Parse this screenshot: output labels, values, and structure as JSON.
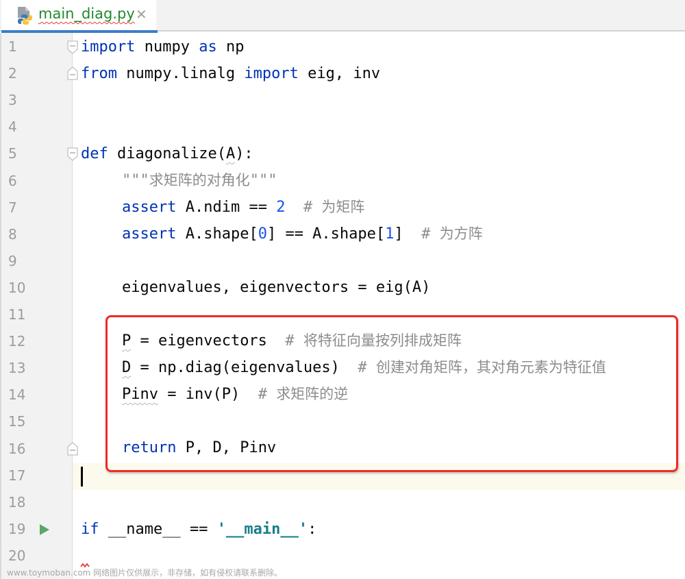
{
  "tab": {
    "filename": "main_diag.py",
    "close_symbol": "✕"
  },
  "gutter": {
    "line_numbers": [
      "1",
      "2",
      "3",
      "4",
      "5",
      "6",
      "7",
      "8",
      "9",
      "10",
      "11",
      "12",
      "13",
      "14",
      "15",
      "16",
      "17",
      "18",
      "19",
      "20"
    ],
    "current_line": "17",
    "run_line": "19"
  },
  "code": {
    "l1": {
      "kw1": "import",
      "t1": " numpy ",
      "kw2": "as",
      "t2": " np"
    },
    "l2": {
      "kw1": "from",
      "t1": " numpy.linalg ",
      "kw2": "import",
      "t2": " eig, inv"
    },
    "l5": {
      "kw": "def",
      "t1": " diagonalize(",
      "param": "A",
      "t2": "):"
    },
    "l6": {
      "q1": "\"\"\"",
      "doc": "求矩阵的对角化",
      "q2": "\"\"\""
    },
    "l7": {
      "kw": "assert",
      "t1": " A.ndim == ",
      "num": "2",
      "cm_hash": "  # ",
      "cm": "为矩阵"
    },
    "l8": {
      "kw": "assert",
      "t1": " A.shape[",
      "n1": "0",
      "t2": "] == A.shape[",
      "n2": "1",
      "t3": "]",
      "cm_hash": "  # ",
      "cm": "为方阵"
    },
    "l10": {
      "t": "eigenvalues, eigenvectors = eig(A)"
    },
    "l12": {
      "var": "P",
      "t": " = eigenvectors",
      "cm_hash": "  # ",
      "cm": "将特征向量按列排成矩阵"
    },
    "l13": {
      "var": "D",
      "t": " = np.diag(eigenvalues)",
      "cm_hash": "  # ",
      "cm": "创建对角矩阵，其对角元素为特征值"
    },
    "l14": {
      "var": "Pinv",
      "t": " = inv(P)",
      "cm_hash": "  # ",
      "cm": "求矩阵的逆"
    },
    "l16": {
      "kw": "return",
      "t": " P, D, Pinv"
    },
    "l19": {
      "kw": "if",
      "t1": " __name__ == ",
      "str": "'__main__'",
      "t2": ":"
    }
  },
  "watermark": "www.toymoban.com 网络图片仅供展示，非存储，如有侵权请联系删除。",
  "colors": {
    "keyword": "#0033b3",
    "number": "#1750eb",
    "comment": "#8c8c8c",
    "string": "#177e89",
    "tab_label": "#218a2c",
    "tab_underline": "#3c7dc9",
    "highlight_box": "#ee2b24",
    "run_icon": "#59a869"
  }
}
